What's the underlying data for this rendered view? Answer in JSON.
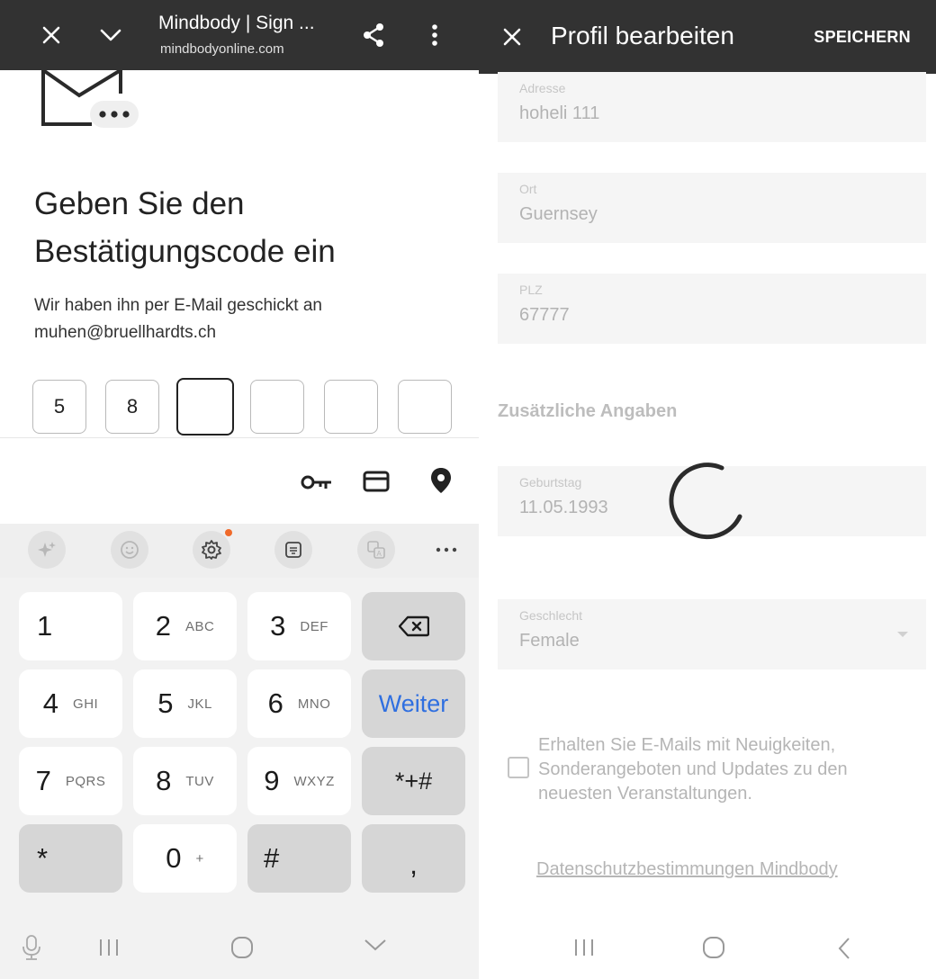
{
  "browser": {
    "close_icon": "close-icon",
    "minimize_icon": "chevron-down-icon",
    "title": "Mindbody | Sign ...",
    "url": "mindbodyonline.com",
    "share_icon": "share-icon",
    "menu_icon": "more-vert-icon"
  },
  "verification": {
    "title": "Geben Sie den Bestätigungscode ein",
    "description": "Wir haben ihn per E-Mail geschickt an muhen@bruellhardts.ch",
    "code_digits": [
      "5",
      "8",
      "",
      "",
      "",
      ""
    ],
    "active_index": 2
  },
  "keyboard": {
    "autofill_icons": [
      "key-icon",
      "card-icon",
      "location-pin-icon"
    ],
    "toolbar_icons": [
      "sparkle-icon",
      "emoji-icon",
      "settings-icon",
      "clipboard-keyboard-icon",
      "translate-icon",
      "more-horiz-icon"
    ],
    "keys": {
      "k1": {
        "num": "1",
        "letters": ""
      },
      "k2": {
        "num": "2",
        "letters": "ABC"
      },
      "k3": {
        "num": "3",
        "letters": "DEF"
      },
      "k4": {
        "num": "4",
        "letters": "GHI"
      },
      "k5": {
        "num": "5",
        "letters": "JKL"
      },
      "k6": {
        "num": "6",
        "letters": "MNO"
      },
      "k7": {
        "num": "7",
        "letters": "PQRS"
      },
      "k8": {
        "num": "8",
        "letters": "TUV"
      },
      "k9": {
        "num": "9",
        "letters": "WXYZ"
      },
      "k0": {
        "num": "0",
        "letters": "+"
      },
      "star": "*",
      "hash": "#",
      "comma": ",",
      "symbols": "*+#",
      "action": "Weiter"
    }
  },
  "profile": {
    "title": "Profil bearbeiten",
    "save_label": "SPEICHERN",
    "fields": {
      "address": {
        "label": "Adresse",
        "value": "hoheli 111"
      },
      "city": {
        "label": "Ort",
        "value": "Guernsey"
      },
      "zip": {
        "label": "PLZ",
        "value": "67777"
      },
      "birthday": {
        "label": "Geburtstag",
        "value": "11.05.1993"
      },
      "gender": {
        "label": "Geschlecht",
        "value": "Female"
      }
    },
    "section_additional": "Zusätzliche Angaben",
    "newsletter_label": "Erhalten Sie E-Mails mit Neuigkeiten, Sonderangeboten und Updates zu den neuesten Veranstaltungen.",
    "newsletter_checked": false,
    "privacy_link": "Datenschutzbestimmungen Mindbody",
    "loading": true
  }
}
